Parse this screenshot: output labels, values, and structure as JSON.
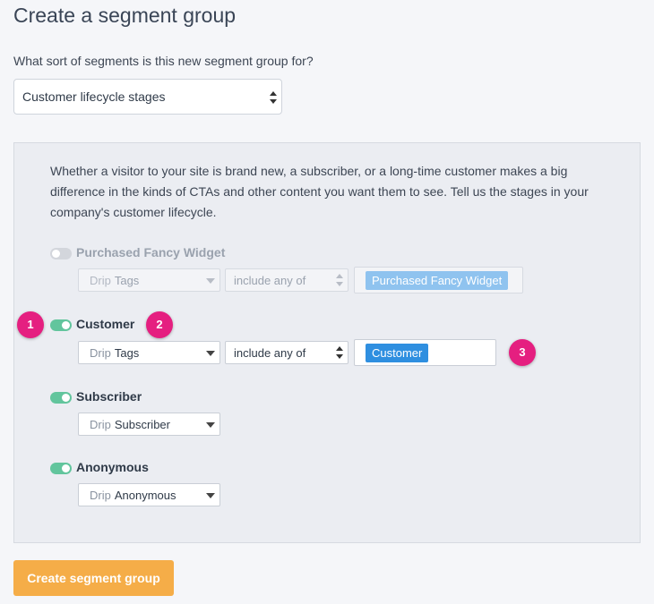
{
  "page": {
    "title": "Create a segment group",
    "question": "What sort of segments is this new segment group for?"
  },
  "type_select": {
    "value": "Customer lifecycle stages"
  },
  "panel": {
    "intro": "Whether a visitor to your site is brand new, a subscriber, or a long-time customer makes a big difference in the kinds of CTAs and other content you want them to see. Tell us the stages in your company's customer lifecycle.",
    "segments": [
      {
        "name": "Purchased Fancy Widget",
        "enabled": false,
        "source_prefix": "Drip",
        "source_value": "Tags",
        "operator": "include any of",
        "tag": "Purchased Fancy Widget"
      },
      {
        "name": "Customer",
        "enabled": true,
        "source_prefix": "Drip",
        "source_value": "Tags",
        "operator": "include any of",
        "tag": "Customer"
      },
      {
        "name": "Subscriber",
        "enabled": true,
        "source_prefix": "Drip",
        "source_value": "Subscriber"
      },
      {
        "name": "Anonymous",
        "enabled": true,
        "source_prefix": "Drip",
        "source_value": "Anonymous"
      }
    ]
  },
  "badges": [
    "1",
    "2",
    "3"
  ],
  "actions": {
    "create_label": "Create segment group"
  },
  "colors": {
    "toggle_on": "#62c59d",
    "tag_blue": "#2f8fe0",
    "badge_pink": "#e51f80",
    "create_button": "#f5ad48"
  }
}
